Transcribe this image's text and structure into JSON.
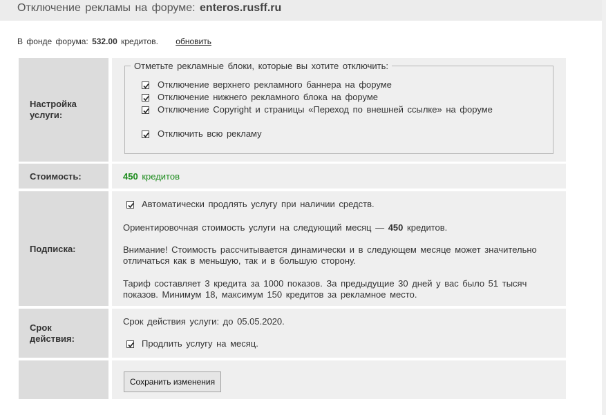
{
  "header": {
    "title_prefix": "Отключение рекламы на форуме:",
    "forum_name": "enteros.rusff.ru"
  },
  "fund": {
    "prefix": "В фонде форума:",
    "amount": "532.00",
    "suffix": "кредитов.",
    "refresh_label": "обновить"
  },
  "settings": {
    "label": "Настройка услуги:",
    "legend": "Отметьте рекламные блоки, которые вы хотите отключить:",
    "options": [
      {
        "label": "Отключение верхнего рекламного баннера на форуме",
        "checked": true
      },
      {
        "label": "Отключение нижнего рекламного блока на форуме",
        "checked": true
      },
      {
        "label": "Отключение Copyright и страницы «Переход по внешней ссылке» на форуме",
        "checked": true
      },
      {
        "label": "Отключить всю рекламу",
        "checked": true
      }
    ]
  },
  "cost": {
    "label": "Стоимость:",
    "amount": "450",
    "unit": "кредитов"
  },
  "subscription": {
    "label": "Подписка:",
    "autorenew_label": "Автоматически продлять услугу при наличии средств.",
    "estimate_prefix": "Ориентировочная стоимость услуги на следующий месяц —",
    "estimate_amount": "450",
    "estimate_suffix": "кредитов.",
    "warning_line1": "Внимание! Стоимость рассчитывается динамически и в следующем месяце может значительно",
    "warning_line2": "отличаться как в меньшую, так и в большую сторону.",
    "tariff_line1": "Тариф составляет 3 кредита за 1000 показов. За предыдущие 30 дней у вас было 51 тысяч",
    "tariff_line2": "показов. Минимум 18, максимум 150 кредитов за рекламное место."
  },
  "term": {
    "label": "Срок действия:",
    "valid_until": "Срок действия услуги: до 05.05.2020.",
    "extend_label": "Продлить услугу на месяц."
  },
  "save_button_label": "Сохранить изменения"
}
